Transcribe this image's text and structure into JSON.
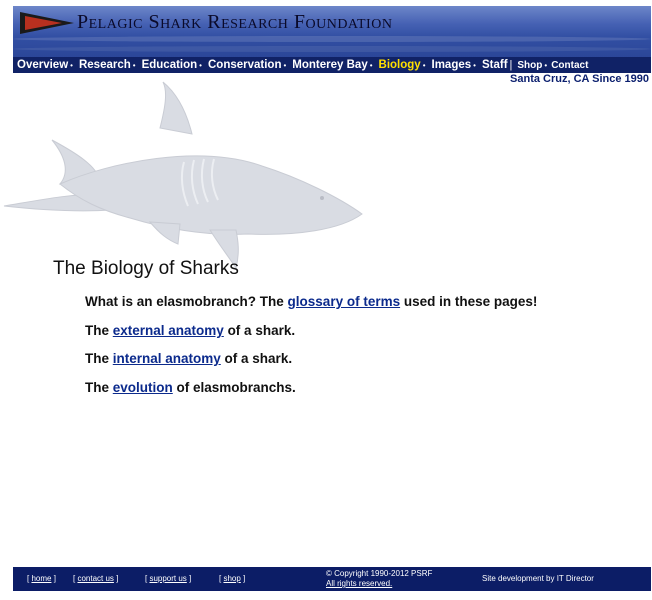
{
  "header": {
    "title": "Pelagic Shark Research Foundation",
    "tagline": "Santa Cruz, CA Since 1990"
  },
  "nav": {
    "overview": "Overview",
    "research": "Research",
    "education": "Education",
    "conservation": "Conservation",
    "monterey_bay": "Monterey Bay",
    "biology": "Biology",
    "images": "Images",
    "staff": "Staff",
    "shop": "Shop",
    "contact": "Contact"
  },
  "main": {
    "title": "The Biology of Sharks",
    "lines": [
      {
        "pre": "What is an elasmobranch? The ",
        "link": "glossary of terms",
        "post": " used in these pages!"
      },
      {
        "pre": "The ",
        "link": "external anatomy",
        "post": " of a shark."
      },
      {
        "pre": "The ",
        "link": "internal anatomy",
        "post": " of a shark."
      },
      {
        "pre": "The ",
        "link": "evolution",
        "post": " of elasmobranchs."
      }
    ]
  },
  "footer": {
    "home": "home",
    "contact": "contact us",
    "support": "support us",
    "shop": "shop",
    "copyright": "© Copyright 1990-2012 PSRF",
    "rights": "All rights reserved.",
    "credit": "Site development by IT Director"
  },
  "colors": {
    "nav_bg": "#102266",
    "active": "#ffe000",
    "link": "#0b2a8c"
  }
}
